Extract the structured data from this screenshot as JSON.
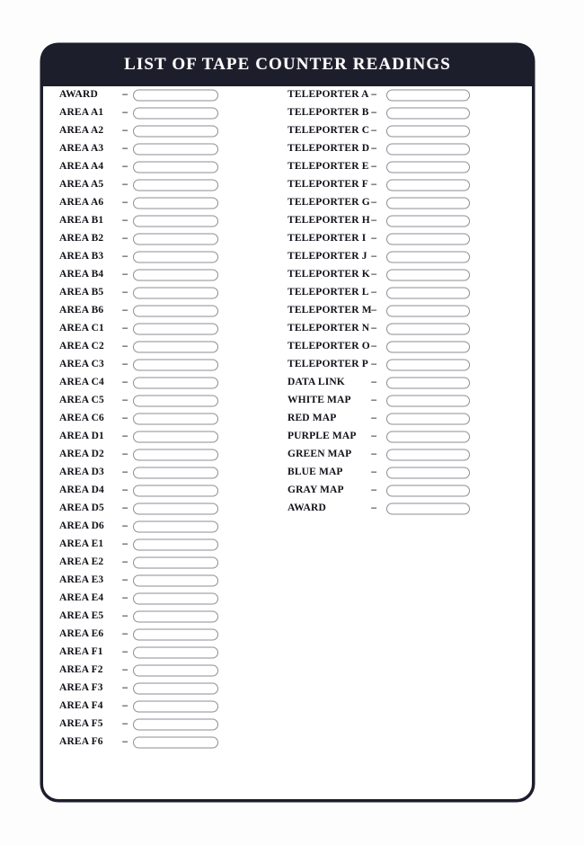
{
  "card": {
    "title": "LIST OF TAPE COUNTER READINGS",
    "accent_color": "#1d1e2b",
    "paper_color": "#ffffff",
    "field_border_color": "#8e8e95",
    "separator": "–",
    "field_placeholder": ""
  },
  "columns": {
    "left": [
      {
        "label": "AWARD",
        "separator": "–",
        "value": ""
      },
      {
        "label": "AREA A1",
        "separator": "–",
        "value": ""
      },
      {
        "label": "AREA A2",
        "separator": "–",
        "value": ""
      },
      {
        "label": "AREA A3",
        "separator": "–",
        "value": ""
      },
      {
        "label": "AREA A4",
        "separator": "–",
        "value": ""
      },
      {
        "label": "AREA A5",
        "separator": "–",
        "value": ""
      },
      {
        "label": "AREA A6",
        "separator": "–",
        "value": ""
      },
      {
        "label": "AREA B1",
        "separator": "–",
        "value": ""
      },
      {
        "label": "AREA B2",
        "separator": "–",
        "value": ""
      },
      {
        "label": "AREA B3",
        "separator": "–",
        "value": ""
      },
      {
        "label": "AREA B4",
        "separator": "–",
        "value": ""
      },
      {
        "label": "AREA B5",
        "separator": "–",
        "value": ""
      },
      {
        "label": "AREA B6",
        "separator": "–",
        "value": ""
      },
      {
        "label": "AREA C1",
        "separator": "–",
        "value": ""
      },
      {
        "label": "AREA C2",
        "separator": "–",
        "value": ""
      },
      {
        "label": "AREA C3",
        "separator": "–",
        "value": ""
      },
      {
        "label": "AREA C4",
        "separator": "–",
        "value": ""
      },
      {
        "label": "AREA C5",
        "separator": "–",
        "value": ""
      },
      {
        "label": "AREA C6",
        "separator": "–",
        "value": ""
      },
      {
        "label": "AREA D1",
        "separator": "–",
        "value": ""
      },
      {
        "label": "AREA D2",
        "separator": "–",
        "value": ""
      },
      {
        "label": "AREA D3",
        "separator": "–",
        "value": ""
      },
      {
        "label": "AREA D4",
        "separator": "–",
        "value": ""
      },
      {
        "label": "AREA D5",
        "separator": "–",
        "value": ""
      },
      {
        "label": "AREA D6",
        "separator": "–",
        "value": ""
      },
      {
        "label": "AREA E1",
        "separator": "–",
        "value": ""
      },
      {
        "label": "AREA E2",
        "separator": "–",
        "value": ""
      },
      {
        "label": "AREA E3",
        "separator": "–",
        "value": ""
      },
      {
        "label": "AREA E4",
        "separator": "–",
        "value": ""
      },
      {
        "label": "AREA E5",
        "separator": "–",
        "value": ""
      },
      {
        "label": "AREA E6",
        "separator": "–",
        "value": ""
      },
      {
        "label": "AREA F1",
        "separator": "–",
        "value": ""
      },
      {
        "label": "AREA F2",
        "separator": "–",
        "value": ""
      },
      {
        "label": "AREA F3",
        "separator": "–",
        "value": ""
      },
      {
        "label": "AREA F4",
        "separator": "–",
        "value": ""
      },
      {
        "label": "AREA F5",
        "separator": "–",
        "value": ""
      },
      {
        "label": "AREA F6",
        "separator": "–",
        "value": ""
      }
    ],
    "right": [
      {
        "label": "TELEPORTER A",
        "separator": "–",
        "value": ""
      },
      {
        "label": "TELEPORTER B",
        "separator": "–",
        "value": ""
      },
      {
        "label": "TELEPORTER C",
        "separator": "–",
        "value": ""
      },
      {
        "label": "TELEPORTER D",
        "separator": "–",
        "value": ""
      },
      {
        "label": "TELEPORTER E",
        "separator": "–",
        "value": ""
      },
      {
        "label": "TELEPORTER F",
        "separator": "–",
        "value": ""
      },
      {
        "label": "TELEPORTER G",
        "separator": "–",
        "value": ""
      },
      {
        "label": "TELEPORTER H",
        "separator": "–",
        "value": ""
      },
      {
        "label": "TELEPORTER I",
        "separator": "–",
        "value": ""
      },
      {
        "label": "TELEPORTER J",
        "separator": "–",
        "value": ""
      },
      {
        "label": "TELEPORTER K",
        "separator": "–",
        "value": ""
      },
      {
        "label": "TELEPORTER L",
        "separator": "–",
        "value": ""
      },
      {
        "label": "TELEPORTER M",
        "separator": "–",
        "value": ""
      },
      {
        "label": "TELEPORTER N",
        "separator": "–",
        "value": ""
      },
      {
        "label": "TELEPORTER O",
        "separator": "–",
        "value": ""
      },
      {
        "label": "TELEPORTER P",
        "separator": "–",
        "value": ""
      },
      {
        "label": "DATA LINK",
        "separator": "–",
        "value": ""
      },
      {
        "label": "WHITE MAP",
        "separator": "–",
        "value": ""
      },
      {
        "label": "RED MAP",
        "separator": "–",
        "value": ""
      },
      {
        "label": "PURPLE MAP",
        "separator": "–",
        "value": ""
      },
      {
        "label": "GREEN MAP",
        "separator": "–",
        "value": ""
      },
      {
        "label": "BLUE MAP",
        "separator": "–",
        "value": ""
      },
      {
        "label": "GRAY MAP",
        "separator": "–",
        "value": ""
      },
      {
        "label": "AWARD",
        "separator": "–",
        "value": ""
      }
    ]
  }
}
